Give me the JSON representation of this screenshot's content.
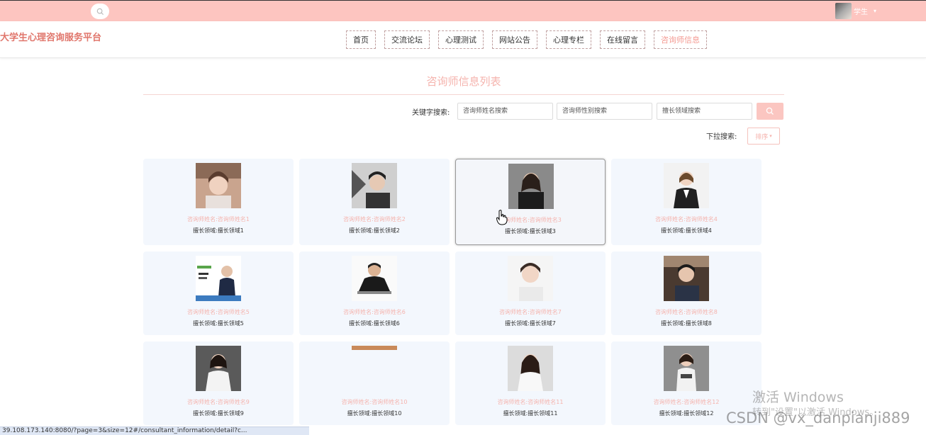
{
  "topbar": {
    "search_icon": "search-icon",
    "user_name": "学生",
    "caret": "▾"
  },
  "header": {
    "site_title": "大学生心理咨询服务平台",
    "nav": [
      {
        "label": "首页"
      },
      {
        "label": "交流论坛"
      },
      {
        "label": "心理测试"
      },
      {
        "label": "网站公告"
      },
      {
        "label": "心理专栏"
      },
      {
        "label": "在线留言"
      },
      {
        "label": "咨询师信息"
      }
    ],
    "active_index": 6,
    "accent_color": "#f49a92",
    "topbar_color": "#fdc5c0"
  },
  "main": {
    "title": "咨询师信息列表",
    "search": {
      "label": "关键字搜索:",
      "name_placeholder": "咨询师姓名搜索",
      "gender_placeholder": "咨询师性别搜索",
      "field_placeholder": "擅长领域搜索",
      "button_icon": "search-icon"
    },
    "dropdown": {
      "label": "下拉搜索:",
      "sort_label": "排序",
      "sort_caret": "▾"
    },
    "cards": [
      {
        "name": "咨询师姓名:咨询师姓名1",
        "field": "擅长领域:擅长领域1"
      },
      {
        "name": "咨询师姓名:咨询师姓名2",
        "field": "擅长领域:擅长领域2"
      },
      {
        "name": "咨询师姓名:咨询师姓名3",
        "field": "擅长领域:擅长领域3"
      },
      {
        "name": "咨询师姓名:咨询师姓名4",
        "field": "擅长领域:擅长领域4"
      },
      {
        "name": "咨询师姓名:咨询师姓名5",
        "field": "擅长领域:擅长领域5"
      },
      {
        "name": "咨询师姓名:咨询师姓名6",
        "field": "擅长领域:擅长领域6"
      },
      {
        "name": "咨询师姓名:咨询师姓名7",
        "field": "擅长领域:擅长领域7"
      },
      {
        "name": "咨询师姓名:咨询师姓名8",
        "field": "擅长领域:擅长领域8"
      },
      {
        "name": "咨询师姓名:咨询师姓名9",
        "field": "擅长领域:擅长领域9"
      },
      {
        "name": "咨询师姓名:咨询师姓名10",
        "field": "擅长领域:擅长领域10"
      },
      {
        "name": "咨询师姓名:咨询师姓名11",
        "field": "擅长领域:擅长领域11"
      },
      {
        "name": "咨询师姓名:咨询师姓名12",
        "field": "擅长领域:擅长领域12"
      }
    ],
    "hovered_index": 2
  },
  "overlay": {
    "activate_windows": "激活 Windows",
    "activate_hint": "转到\"设置\"以激活 Windows。",
    "csdn_watermark": "CSDN @vx_danpianji889"
  },
  "statusbar": {
    "url": "39.108.173.140:8080/?page=3&size=12#/consultant_information/detail?c..."
  }
}
